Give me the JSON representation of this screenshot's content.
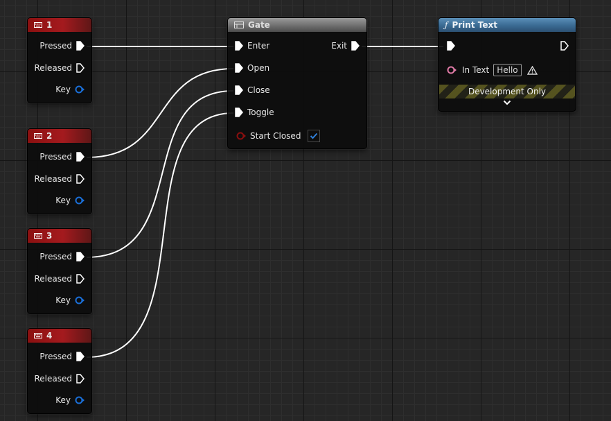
{
  "key_nodes": [
    {
      "title": "1",
      "pressed": "Pressed",
      "released": "Released",
      "key": "Key"
    },
    {
      "title": "2",
      "pressed": "Pressed",
      "released": "Released",
      "key": "Key"
    },
    {
      "title": "3",
      "pressed": "Pressed",
      "released": "Released",
      "key": "Key"
    },
    {
      "title": "4",
      "pressed": "Pressed",
      "released": "Released",
      "key": "Key"
    }
  ],
  "gate": {
    "title": "Gate",
    "enter": "Enter",
    "open": "Open",
    "close": "Close",
    "toggle": "Toggle",
    "start_closed": "Start Closed",
    "start_closed_checked": true,
    "exit": "Exit"
  },
  "print_text": {
    "title": "Print Text",
    "in_text_label": "In Text",
    "in_text_value": "Hello",
    "dev_only": "Development Only"
  },
  "colors": {
    "key_header": "#a41a1e",
    "gate_header": "#8a8a8a",
    "func_header": "#3a6a92",
    "exec_wire": "#ffffff",
    "key_pin": "#1a6fd8",
    "bool_pin": "#8a0f0f",
    "text_pin": "#e07aa6",
    "check": "#2f7fd9"
  },
  "icons": [
    "keyboard-icon",
    "gate-icon",
    "function-icon",
    "warning-icon",
    "chevron-down-icon"
  ]
}
